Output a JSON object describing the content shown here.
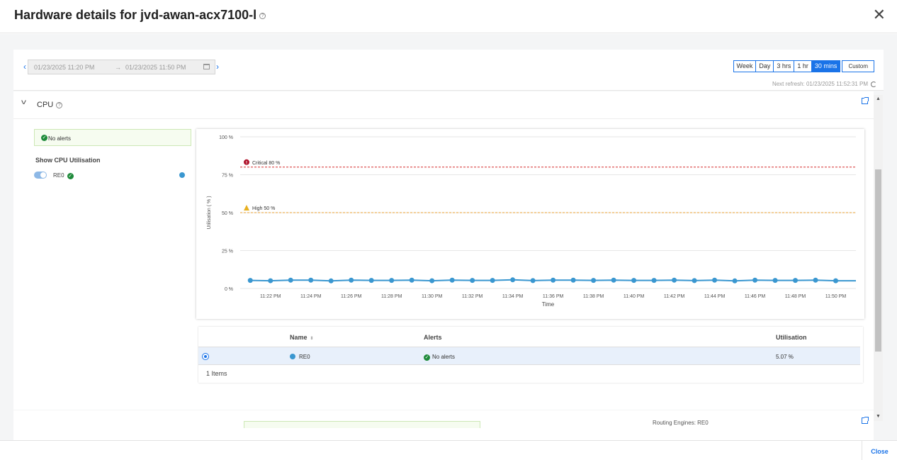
{
  "header": {
    "title": "Hardware details for jvd-awan-acx7100-l"
  },
  "toolbar": {
    "date_from": "01/23/2025 11:20 PM",
    "arrow": "→",
    "date_to": "01/23/2025 11:50 PM",
    "time_buttons": [
      "Week",
      "Day",
      "3 hrs",
      "1 hr",
      "30 mins"
    ],
    "active_time": "30 mins",
    "custom_label": "Custom",
    "next_refresh": "Next refresh: 01/23/2025 11:52:31 PM"
  },
  "cpu": {
    "title": "CPU",
    "alert_text": "No alerts",
    "show_label": "Show CPU Utilisation",
    "series_label": "RE0"
  },
  "chart_data": {
    "type": "line",
    "ylabel": "Utilisation ( % )",
    "xlabel": "Time",
    "ylim": [
      0,
      100
    ],
    "yticks": [
      "0 %",
      "25 %",
      "50 %",
      "75 %",
      "100 %"
    ],
    "xticks": [
      "11:22 PM",
      "11:24 PM",
      "11:26 PM",
      "11:28 PM",
      "11:30 PM",
      "11:32 PM",
      "11:34 PM",
      "11:36 PM",
      "11:38 PM",
      "11:40 PM",
      "11:42 PM",
      "11:44 PM",
      "11:46 PM",
      "11:48 PM",
      "11:50 PM"
    ],
    "thresholds": [
      {
        "label": "Critical 80 %",
        "value": 80,
        "color": "#d62b2b"
      },
      {
        "label": "High 50 %",
        "value": 50,
        "color": "#e8a030"
      }
    ],
    "series": [
      {
        "name": "RE0",
        "color": "#3a97d0",
        "x_minutes": [
          21,
          22,
          23,
          24,
          25,
          26,
          27,
          28,
          29,
          30,
          31,
          32,
          33,
          34,
          35,
          36,
          37,
          38,
          39,
          40,
          41,
          42,
          43,
          44,
          45,
          46,
          47,
          48,
          49,
          50
        ],
        "values": [
          5.3,
          5.1,
          5.5,
          5.5,
          5.0,
          5.5,
          5.3,
          5.3,
          5.5,
          5.1,
          5.5,
          5.3,
          5.3,
          5.7,
          5.2,
          5.5,
          5.5,
          5.3,
          5.5,
          5.3,
          5.3,
          5.5,
          5.2,
          5.5,
          5.0,
          5.5,
          5.3,
          5.3,
          5.5,
          5.07
        ]
      }
    ]
  },
  "table": {
    "headers": {
      "name": "Name",
      "alerts": "Alerts",
      "utilisation": "Utilisation"
    },
    "rows": [
      {
        "name": "RE0",
        "alerts": "No alerts",
        "utilisation": "5.07 %"
      }
    ],
    "items_count": "1 Items"
  },
  "lower": {
    "label": "Routing Engines: RE0"
  },
  "footer": {
    "close_label": "Close"
  }
}
